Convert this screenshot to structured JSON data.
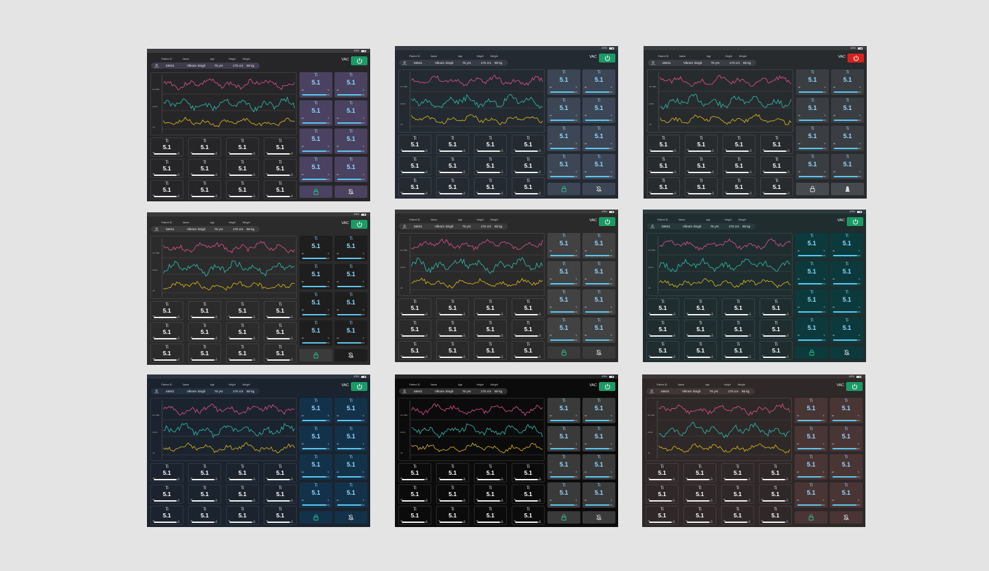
{
  "status": {
    "battery": "43%"
  },
  "patient": {
    "labels": {
      "id": "Patient ID",
      "name": "Name",
      "age": "Age",
      "height": "Height",
      "weight": "Weight"
    },
    "values": {
      "id": "16641",
      "name": "Vikram Singh",
      "age": "75 yrs",
      "height": "175 cm",
      "weight": "65 kg"
    }
  },
  "mode": {
    "label": "VAC"
  },
  "graph": {
    "labels": [
      "cm H2o",
      "L/min",
      "ml"
    ],
    "colors": {
      "pressure": "#e5528f",
      "flow": "#2fc1b1",
      "volume": "#e1bd1a"
    }
  },
  "parameter": {
    "name": "Ti",
    "value": "5.1",
    "min": "40",
    "max": "5",
    "level": 0.88
  },
  "themes": [
    {
      "name": "purple",
      "bg": "#262628",
      "sb": "#3b3b3e",
      "pill": "#3f3d4c",
      "pw": "#1b9a66",
      "gbg": "#262628",
      "cb": "#3d3d42",
      "tbg": "#262628",
      "sbg": "#4a4260",
      "lb": "#4a4260",
      "bb": "#4a4260",
      "lock": "#2fc08b",
      "bell": "#dddddd",
      "bellStyle": "muted"
    },
    {
      "name": "slate",
      "bg": "#242a31",
      "sb": "#333a42",
      "pill": "#353c47",
      "pw": "#1b9a66",
      "gbg": "#242a31",
      "cb": "#37404a",
      "tbg": "#242a31",
      "sbg": "#3c4654",
      "lb": "#3c4654",
      "bb": "#3c4654",
      "lock": "#2fc08b",
      "bell": "#dddddd",
      "bellStyle": "muted"
    },
    {
      "name": "graphite",
      "bg": "#282b2d",
      "sb": "#3a3d40",
      "pill": "#3a3e42",
      "pw": "#d62121",
      "gbg": "#282b2d",
      "cb": "#3f4346",
      "tbg": "#282b2d",
      "sbg": "#3a3e42",
      "lb": "#464a4e",
      "bb": "#464a4e",
      "lock": "#dddddd",
      "bell": "#dddddd",
      "bellStyle": "active"
    },
    {
      "name": "charcoal",
      "bg": "#2b2b2b",
      "sb": "#3a3a3a",
      "pill": "#3b3b3b",
      "pw": "#1b9a66",
      "gbg": "#2b2b2b",
      "cb": "#404040",
      "tbg": "#2b2b2b",
      "sbg": "#1e1e1e",
      "lb": "#3b3b3b",
      "bb": "#1e1e1e",
      "lock": "#2fc08b",
      "bell": "#dddddd",
      "bellStyle": "muted"
    },
    {
      "name": "dim-gray",
      "bg": "#2a2a2a",
      "sb": "#383838",
      "pill": "#3a3a3a",
      "pw": "#1b9a66",
      "gbg": "#2a2a2a",
      "cb": "#414141",
      "tbg": "#2a2a2a",
      "sbg": "#424242",
      "lb": "#3a3a3a",
      "bb": "#3a3a3a",
      "lock": "#2fc08b",
      "bell": "#dddddd",
      "bellStyle": "muted"
    },
    {
      "name": "teal",
      "bg": "#1f2d2f",
      "sb": "#2c3c3e",
      "pill": "#263a3c",
      "pw": "#1b9a66",
      "gbg": "#1f2d2f",
      "cb": "#334446",
      "tbg": "#1f2d2f",
      "sbg": "#0c3a3c",
      "lb": "#0c3a3c",
      "bb": "#0c3a3c",
      "lock": "#2fc08b",
      "bell": "#dddddd",
      "bellStyle": "muted"
    },
    {
      "name": "navy",
      "bg": "#1b232e",
      "sb": "#2a3440",
      "pill": "#243140",
      "pw": "#1b9a66",
      "gbg": "#1b232e",
      "cb": "#2d3947",
      "tbg": "#1b232e",
      "sbg": "#13324a",
      "lb": "#13324a",
      "bb": "#13324a",
      "lock": "#2fc08b",
      "bell": "#dddddd",
      "bellStyle": "muted"
    },
    {
      "name": "black",
      "bg": "#0b0b0b",
      "sb": "#262626",
      "pill": "#2f2f2f",
      "pw": "#1b9a66",
      "gbg": "#0b0b0b",
      "cb": "#2a2a2a",
      "tbg": "#0b0b0b",
      "sbg": "#3a3a3a",
      "lb": "#3a3a3a",
      "bb": "#3a3a3a",
      "lock": "#2fc08b",
      "bell": "#dddddd",
      "bellStyle": "muted"
    },
    {
      "name": "mauve",
      "bg": "#2e2828",
      "sb": "#3c3535",
      "pill": "#413636",
      "pw": "#1b9a66",
      "gbg": "#2e2828",
      "cb": "#473c3c",
      "tbg": "#2e2828",
      "sbg": "#4a3535",
      "lb": "#4a3535",
      "bb": "#4a3535",
      "lock": "#2fc08b",
      "bell": "#dddddd",
      "bellStyle": "muted"
    }
  ]
}
